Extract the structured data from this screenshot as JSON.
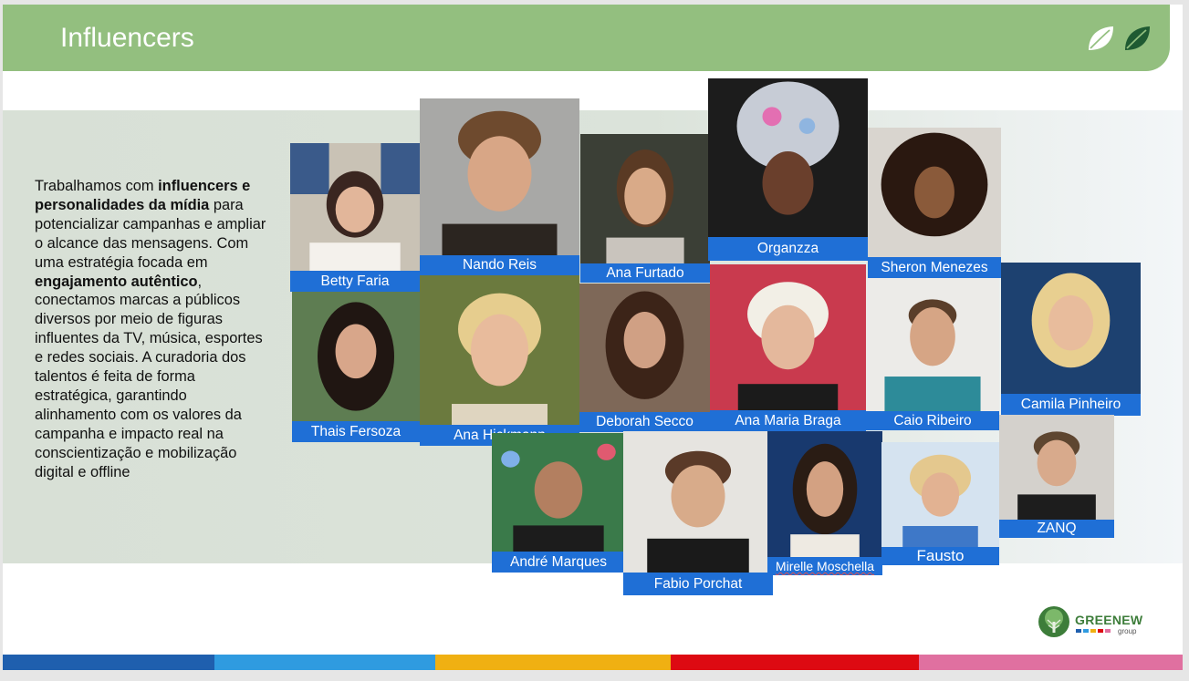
{
  "header": {
    "title": "Influencers",
    "bg_color": "#93bf7f"
  },
  "intro": {
    "t1": "Trabalhamos com ",
    "b1": "influencers e personalidades da mídia",
    "t2": " para potencializar campanhas e ampliar o alcance das mensagens. Com uma estratégia focada em ",
    "b2": "engajamento autêntico",
    "t3": ", conectamos marcas a públicos diversos por meio de figuras influentes da TV, música, esportes e redes sociais. A curadoria dos talentos é feita de forma estratégica, garantindo alinhamento com os valores da campanha e impacto real na conscientização e mobilização digital e offline"
  },
  "influencers": [
    {
      "name": "Betty Faria"
    },
    {
      "name": "Nando Reis"
    },
    {
      "name": "Ana Furtado"
    },
    {
      "name": "Organzza"
    },
    {
      "name": "Sheron Menezes"
    },
    {
      "name": "Thais Fersoza"
    },
    {
      "name": "Ana Hickmann"
    },
    {
      "name": "Deborah Secco"
    },
    {
      "name": "Ana Maria Braga"
    },
    {
      "name": "Caio Ribeiro"
    },
    {
      "name": "Camila Pinheiro"
    },
    {
      "name": "André Marques"
    },
    {
      "name": "Fabio Porchat"
    },
    {
      "name": "Mirelle Moschella"
    },
    {
      "name": "Fausto"
    },
    {
      "name": "ZANQ"
    }
  ],
  "logo": {
    "name": "GREENEW",
    "sub": "group"
  },
  "label_color": "#1f6fd6",
  "stripe_colors": [
    "#1f5fae",
    "#2f9be0",
    "#f0b012",
    "#dd0a12",
    "#e070a0"
  ]
}
